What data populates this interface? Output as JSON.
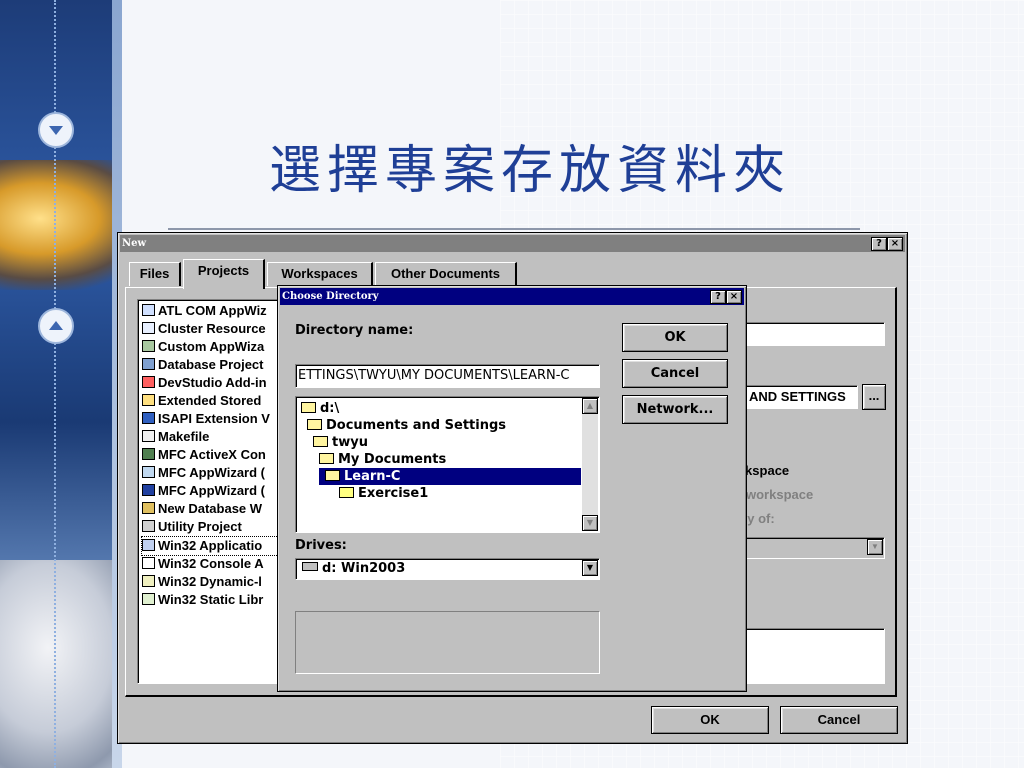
{
  "slide": {
    "title": "選擇專案存放資料夾"
  },
  "new_dialog": {
    "title": "New",
    "help_btn": "?",
    "close_btn": "×",
    "tabs": [
      {
        "label": "Files"
      },
      {
        "label": "Projects"
      },
      {
        "label": "Workspaces"
      },
      {
        "label": "Other Documents"
      }
    ],
    "projects": [
      "ATL COM AppWiz",
      "Cluster Resource",
      "Custom AppWiza",
      "Database Project",
      "DevStudio Add-in",
      "Extended Stored",
      "ISAPI Extension V",
      "Makefile",
      "MFC ActiveX Con",
      "MFC AppWizard (",
      "MFC AppWizard (",
      "New Database W",
      "Utility Project",
      "Win32 Applicatio",
      "Win32 Console A",
      "Win32 Dynamic-l",
      "Win32 Static Libr"
    ],
    "location_value": "AND SETTINGS",
    "browse_btn": "...",
    "radio_create": "rkspace",
    "radio_add": "workspace",
    "dependency_label": "cy of:",
    "ok": "OK",
    "cancel": "Cancel"
  },
  "choose_dir": {
    "title": "Choose Directory",
    "help_btn": "?",
    "close_btn": "×",
    "dirname_label": "Directory name:",
    "dirname_value": "ETTINGS\\TWYU\\MY DOCUMENTS\\LEARN-C",
    "tree": [
      {
        "label": "d:\\",
        "indent": 0,
        "open": true
      },
      {
        "label": "Documents and Settings",
        "indent": 1,
        "open": true
      },
      {
        "label": "twyu",
        "indent": 2,
        "open": true
      },
      {
        "label": "My Documents",
        "indent": 3,
        "open": true
      },
      {
        "label": "Learn-C",
        "indent": 4,
        "open": true,
        "selected": true
      },
      {
        "label": "Exercise1",
        "indent": 5,
        "open": false
      }
    ],
    "drives_label": "Drives:",
    "drive_value": "d: Win2003",
    "ok": "OK",
    "cancel": "Cancel",
    "network": "Network..."
  }
}
